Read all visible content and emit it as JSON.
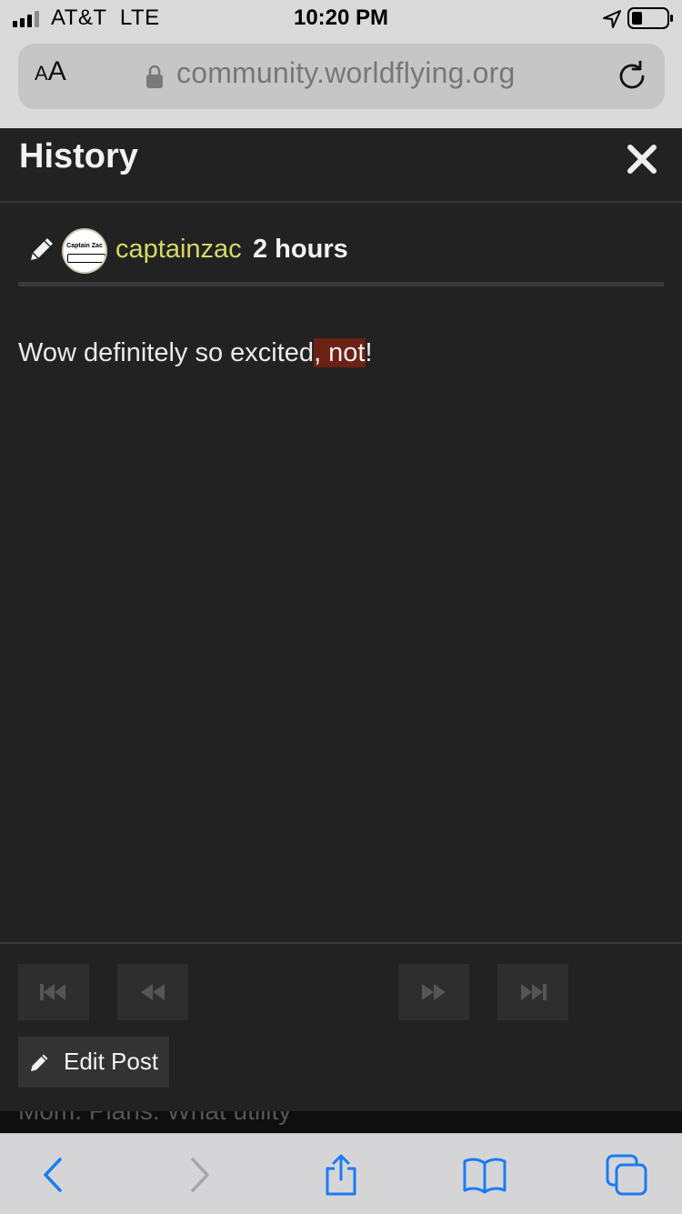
{
  "status_bar": {
    "carrier": "AT&T",
    "network": "LTE",
    "time": "10:20 PM"
  },
  "browser": {
    "text_size_small": "A",
    "text_size_large": "A",
    "url": "community.worldflying.org"
  },
  "modal": {
    "title": "History",
    "revision": {
      "author": "captainzac",
      "age": "2 hours",
      "avatar_text": "Captain Zac"
    },
    "post_text_before": "Wow definitely so excited",
    "post_text_inserted": ", not",
    "post_text_after": "!",
    "edit_button_label": "Edit Post"
  },
  "background_page_text": "Mom. Plans. What utility",
  "colors": {
    "username": "#d6d86a",
    "diff_insert_bg": "#6b2114",
    "modal_bg": "#222222",
    "safari_blue": "#1a7cf5"
  }
}
